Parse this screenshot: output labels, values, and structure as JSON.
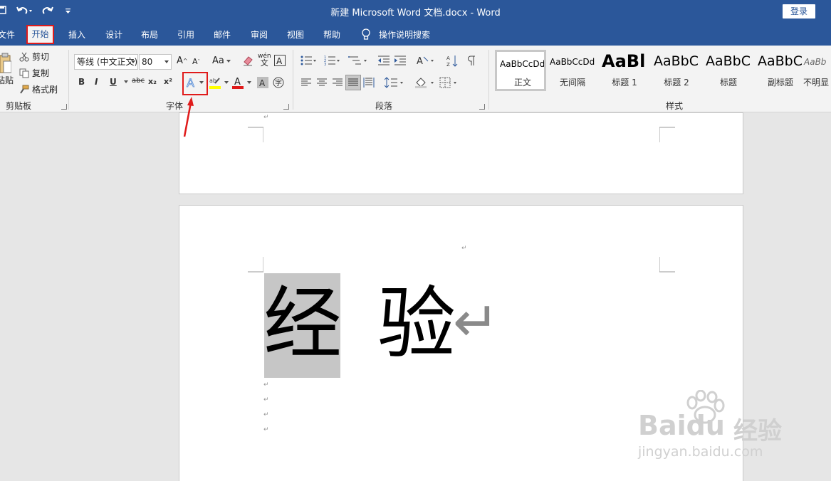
{
  "titlebar": {
    "title": "新建 Microsoft Word 文档.docx  -  Word",
    "login": "登录"
  },
  "tabs": {
    "file": "文件",
    "home": "开始",
    "insert": "插入",
    "design": "设计",
    "layout": "布局",
    "references": "引用",
    "mailings": "邮件",
    "review": "审阅",
    "view": "视图",
    "help": "帮助",
    "search": "操作说明搜索"
  },
  "clipboard": {
    "paste": "粘贴",
    "cut": "剪切",
    "copy": "复制",
    "format_painter": "格式刷",
    "label": "剪贴板"
  },
  "font": {
    "font_name": "等线 (中文正文)",
    "font_size": "80",
    "grow": "A",
    "shrink": "A",
    "change_case": "Aa",
    "phonetic": "wén",
    "bold": "B",
    "italic": "I",
    "underline": "U",
    "strike": "abc",
    "subscript": "x₂",
    "superscript": "x²",
    "label": "字体"
  },
  "paragraph": {
    "label": "段落"
  },
  "styles": {
    "label": "样式",
    "items": [
      {
        "sample": "AaBbCcDd",
        "name": "正文"
      },
      {
        "sample": "AaBbCcDd",
        "name": "无间隔"
      },
      {
        "sample": "AaBl",
        "name": "标题 1"
      },
      {
        "sample": "AaBbC",
        "name": "标题 2"
      },
      {
        "sample": "AaBbC",
        "name": "标题"
      },
      {
        "sample": "AaBbC",
        "name": "副标题"
      },
      {
        "sample": "AaBb",
        "name": "不明显"
      }
    ]
  },
  "document": {
    "char1": "经",
    "char2": "验",
    "return_mark": "↵"
  },
  "watermark": {
    "brand": "Baidu",
    "brand_cn": "经验",
    "url": "jingyan.baidu.com"
  },
  "colors": {
    "ribbon_blue": "#2b579a",
    "highlight_red": "#e01b1b"
  }
}
